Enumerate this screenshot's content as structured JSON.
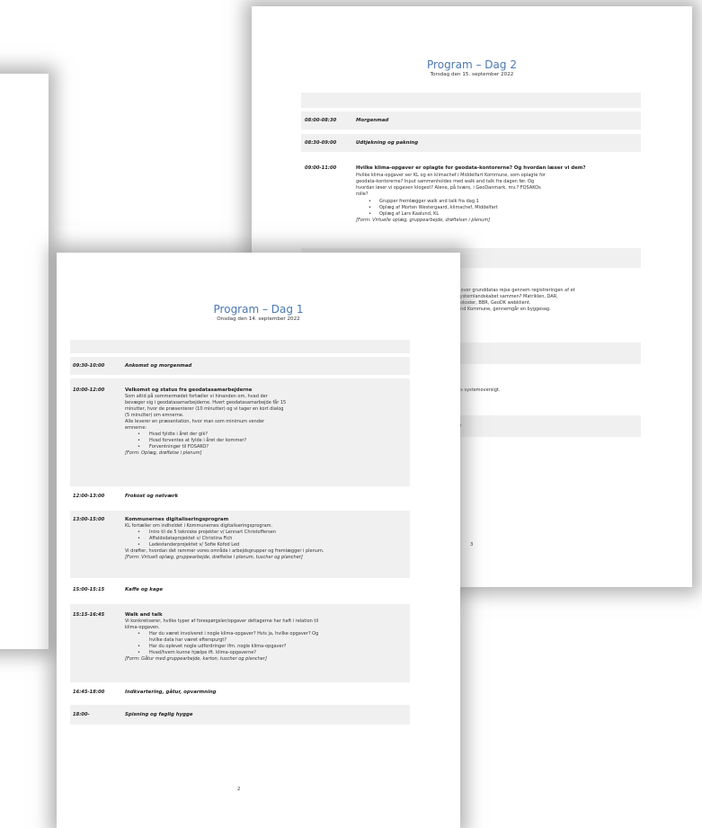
{
  "page2": {
    "title": "Program – Dag 2",
    "subtitle": "Torsdag den 15. september 2022",
    "rows": [
      {
        "time": "08:00-08:30",
        "title": "Morgenmad"
      },
      {
        "time": "08:30-09:00",
        "title": "Udtjekning og pakning"
      },
      {
        "time": "09:00-11:00",
        "title": "Hvilke klima-opgaver er oplagte for geodata-kontorerne? Og hvordan læser vi dem?",
        "lines": [
          "Hvilke klima-opgaver ser KL og en klimachef i Middelfart Kommune, som oplagte for",
          "geodata-kontorerne? Input sammenholdes med walk and talk fra dagen før. Og",
          "hvordan løser vi opgaven klogest? Alene, på tværs, i GeoDanmark, mv.? FOSAKOs",
          "rolle?"
        ],
        "bullets": [
          "Grupper fremlægger walk and talk fra dag 1",
          "Oplæg af Morten Westergaard, klimachef, Middelfart",
          "Oplæg af Lars Kaalund, KL"
        ],
        "form": "[Form: Virtuelle oplæg, gruppearbejde, drøftelser i plenum]"
      }
    ],
    "fragments": [
      "r over grunddatas rejse gennem registreringen af et",
      "systemlandskabet sammen? Matriklen, DAR,",
      "eokoder, BBR, GeoDK webklient.",
      "and Kommune, gennemgår en byggesag.",
      "Ks systemoversigt.",
      "g"
    ],
    "page_number": "3"
  },
  "page1": {
    "title": "Program – Dag 1",
    "subtitle": "Onsdag den 14. september 2022",
    "rows": [
      {
        "time": "09:30-10:00",
        "title": "Ankomst og morgenmad"
      },
      {
        "time": "10:00-12:00",
        "title": "Velkomst og status fra geodatasamarbejderne",
        "lines": [
          "Som altid på sommermødet fortæller vi hinanden om, hvad der",
          "bevæger sig i geodatasamarbejderne. Hvert geodatasamarbejde får 15",
          "minutter, hvor de præsenterer (10 minutter) og vi tager en kort dialog",
          "(5 minutter) om emnerne.",
          "Alle leverer en præsentation, hvor man som minimum vender",
          "emnerne:"
        ],
        "bullets": [
          "Hvad fyldte i året der gik?",
          "Hvad forventes at fylde i året der kommer?",
          "Forventninger til FOSAKO?"
        ],
        "form": "[Form: Oplæg, drøftelse i plenum]"
      },
      {
        "time": "12:00-13:00",
        "title": "Frokost og netværk"
      },
      {
        "time": "13:00-15:00",
        "title": "Kommunernes digitaliseringsprogram",
        "lines": [
          "KL fortæller om indholdet i Kommunernes digitaliseringsprogram."
        ],
        "bullets": [
          "Intro til de 5 tekniske projekter v/ Lennart Christoffersen",
          "Affaldsdataprojektet v/ Christina Fich",
          "Ladestanderprojektet v/ Sofie Kofod Led"
        ],
        "after": [
          "Vi drøfter, hvordan det rammer vores område i arbejdsgrupper og fremlægger i plenum."
        ],
        "form": "[Form: Virtuelt oplæg, gruppearbejde, drøftelse i plenum, tuscher og plancher]"
      },
      {
        "time": "15:00-15:15",
        "title": "Kaffe og kage"
      },
      {
        "time": "15:15-16:45",
        "title": "Walk and talk",
        "lines": [
          "Vi konkretiserer, hvilke typer af forespørgsler/opgaver deltagerne har haft i relation til",
          "klima-opgaven."
        ],
        "bullets": [
          "Har du været involveret i nogle klima-opgaver? Hvis ja, hvilke opgaver? Og",
          "hvilke data har været efterspurgt?",
          "Har du oplevet nogle udfordringer ifm. nogle klima-opgaver?",
          "Hvad/hvem kunne hjælpe ift. klima-opgaverne?"
        ],
        "form": "[Form: Gåtur med gruppearbejde, karton, tuscher og plancher]"
      },
      {
        "time": "16:45-18:00",
        "title": "Indkvartering, gåtur, opvarmning"
      },
      {
        "time": "18:00-",
        "title": "Spisning og faglig hygge"
      }
    ],
    "page_number": "2"
  }
}
